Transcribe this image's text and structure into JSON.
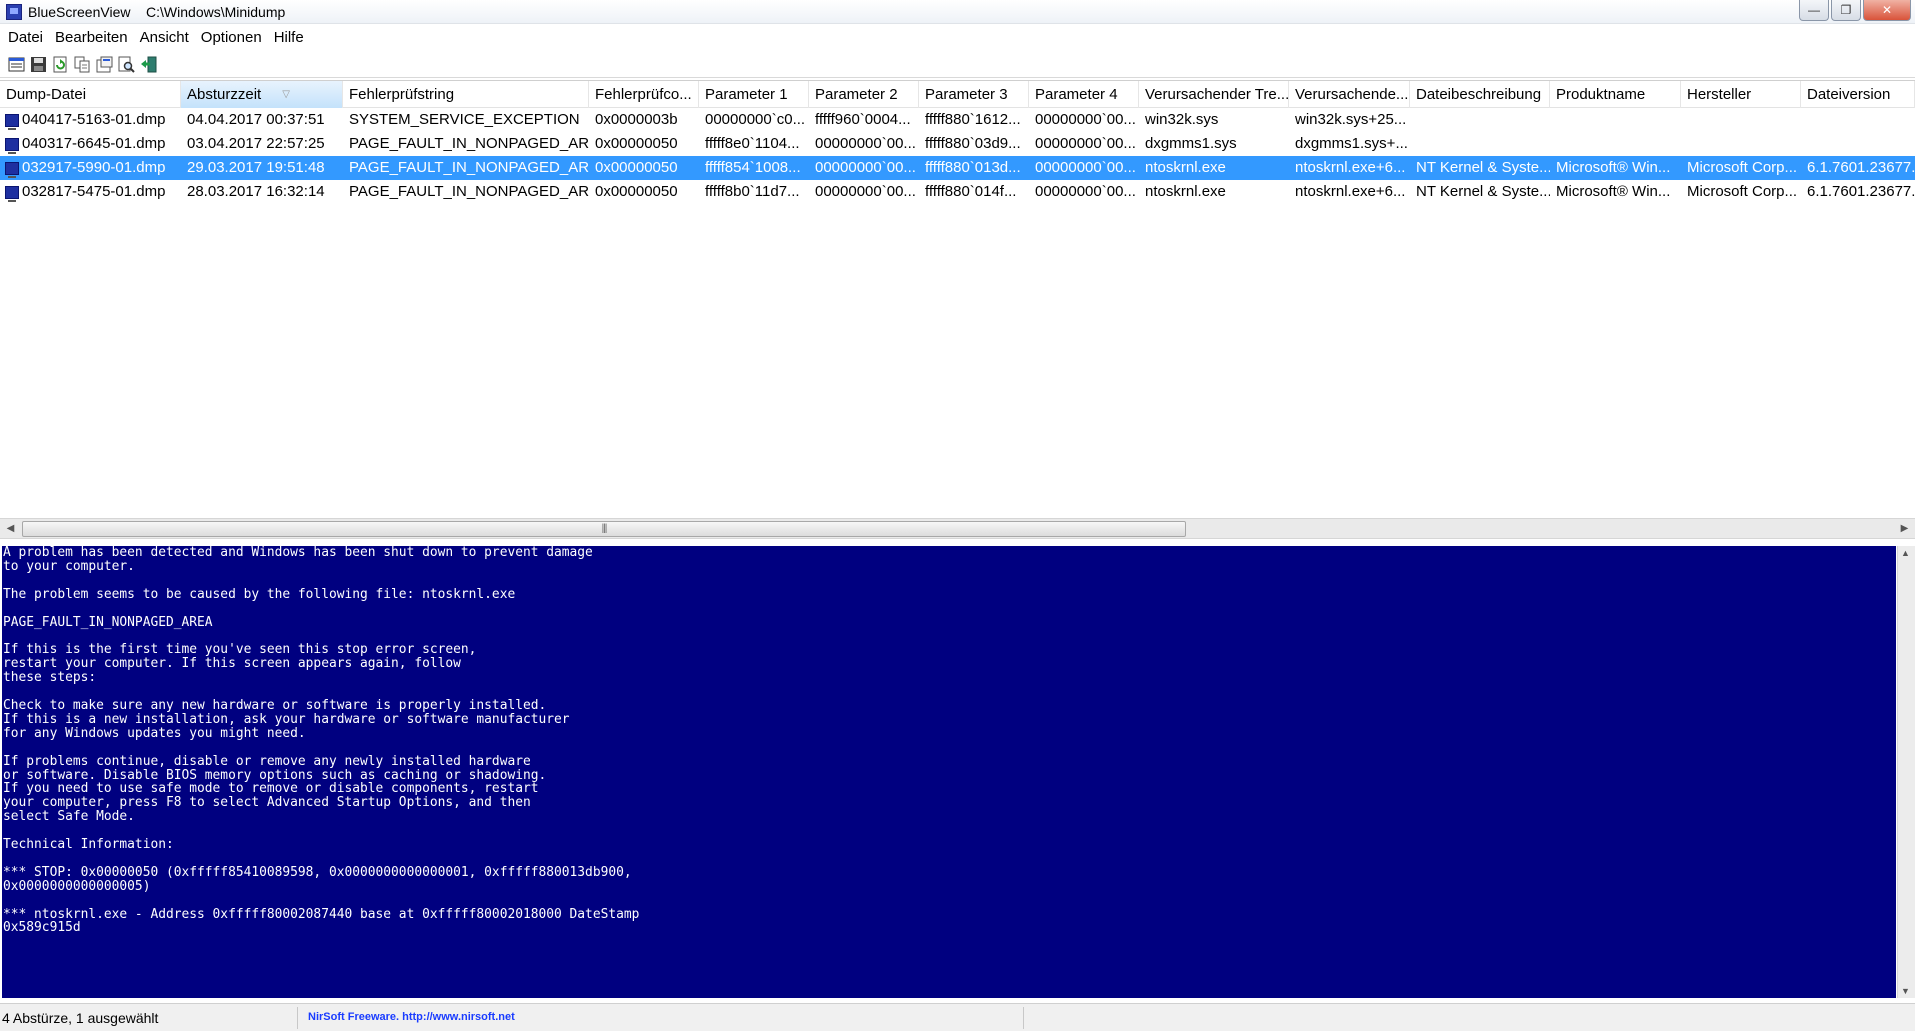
{
  "window": {
    "title": "BlueScreenView    C:\\Windows\\Minidump",
    "minimize_label": "—",
    "maximize_label": "❐",
    "close_label": "✕"
  },
  "menu": {
    "items": [
      "Datei",
      "Bearbeiten",
      "Ansicht",
      "Optionen",
      "Hilfe"
    ]
  },
  "toolbar": {
    "icons": [
      "html-report-icon",
      "save-icon",
      "refresh-icon",
      "copy-icon",
      "properties-icon",
      "find-icon",
      "exit-icon"
    ]
  },
  "table": {
    "columns": [
      "Dump-Datei",
      "Absturzzeit",
      "Fehlerprüfstring",
      "Fehlerprüfco...",
      "Parameter 1",
      "Parameter 2",
      "Parameter 3",
      "Parameter 4",
      "Verursachender Tre...",
      "Verursachende...",
      "Dateibeschreibung",
      "Produktname",
      "Hersteller",
      "Dateiversion"
    ],
    "sorted_column_index": 1,
    "rows": [
      [
        "040417-5163-01.dmp",
        "04.04.2017 00:37:51",
        "SYSTEM_SERVICE_EXCEPTION",
        "0x0000003b",
        "00000000`c0...",
        "fffff960`0004...",
        "fffff880`1612...",
        "00000000`00...",
        "win32k.sys",
        "win32k.sys+25...",
        "",
        "",
        "",
        ""
      ],
      [
        "040317-6645-01.dmp",
        "03.04.2017 22:57:25",
        "PAGE_FAULT_IN_NONPAGED_AREA",
        "0x00000050",
        "fffff8e0`1104...",
        "00000000`00...",
        "fffff880`03d9...",
        "00000000`00...",
        "dxgmms1.sys",
        "dxgmms1.sys+...",
        "",
        "",
        "",
        ""
      ],
      [
        "032917-5990-01.dmp",
        "29.03.2017 19:51:48",
        "PAGE_FAULT_IN_NONPAGED_AREA",
        "0x00000050",
        "fffff854`1008...",
        "00000000`00...",
        "fffff880`013d...",
        "00000000`00...",
        "ntoskrnl.exe",
        "ntoskrnl.exe+6...",
        "NT Kernel & Syste...",
        "Microsoft® Win...",
        "Microsoft Corp...",
        "6.1.7601.23677..."
      ],
      [
        "032817-5475-01.dmp",
        "28.03.2017 16:32:14",
        "PAGE_FAULT_IN_NONPAGED_AREA",
        "0x00000050",
        "fffff8b0`11d7...",
        "00000000`00...",
        "fffff880`014f...",
        "00000000`00...",
        "ntoskrnl.exe",
        "ntoskrnl.exe+6...",
        "NT Kernel & Syste...",
        "Microsoft® Win...",
        "Microsoft Corp...",
        "6.1.7601.23677..."
      ]
    ],
    "selected_row_index": 2
  },
  "bsod": {
    "text": "A problem has been detected and Windows has been shut down to prevent damage\nto your computer.\n\nThe problem seems to be caused by the following file: ntoskrnl.exe\n\nPAGE_FAULT_IN_NONPAGED_AREA\n\nIf this is the first time you've seen this stop error screen,\nrestart your computer. If this screen appears again, follow\nthese steps:\n\nCheck to make sure any new hardware or software is properly installed.\nIf this is a new installation, ask your hardware or software manufacturer\nfor any Windows updates you might need.\n\nIf problems continue, disable or remove any newly installed hardware\nor software. Disable BIOS memory options such as caching or shadowing.\nIf you need to use safe mode to remove or disable components, restart\nyour computer, press F8 to select Advanced Startup Options, and then\nselect Safe Mode.\n\nTechnical Information:\n\n*** STOP: 0x00000050 (0xfffff85410089598, 0x0000000000000001, 0xfffff880013db900,\n0x0000000000000005)\n\n*** ntoskrnl.exe - Address 0xfffff80002087440 base at 0xfffff80002018000 DateStamp\n0x589c915d",
    "background_color": "#000080",
    "text_color": "#ffffff"
  },
  "statusbar": {
    "count_text": "4 Abstürze, 1 ausgewählt",
    "credit_text": "NirSoft Freeware.  http://www.nirsoft.net"
  },
  "colors": {
    "selection": "#3399ff",
    "link": "#1a3cff"
  }
}
